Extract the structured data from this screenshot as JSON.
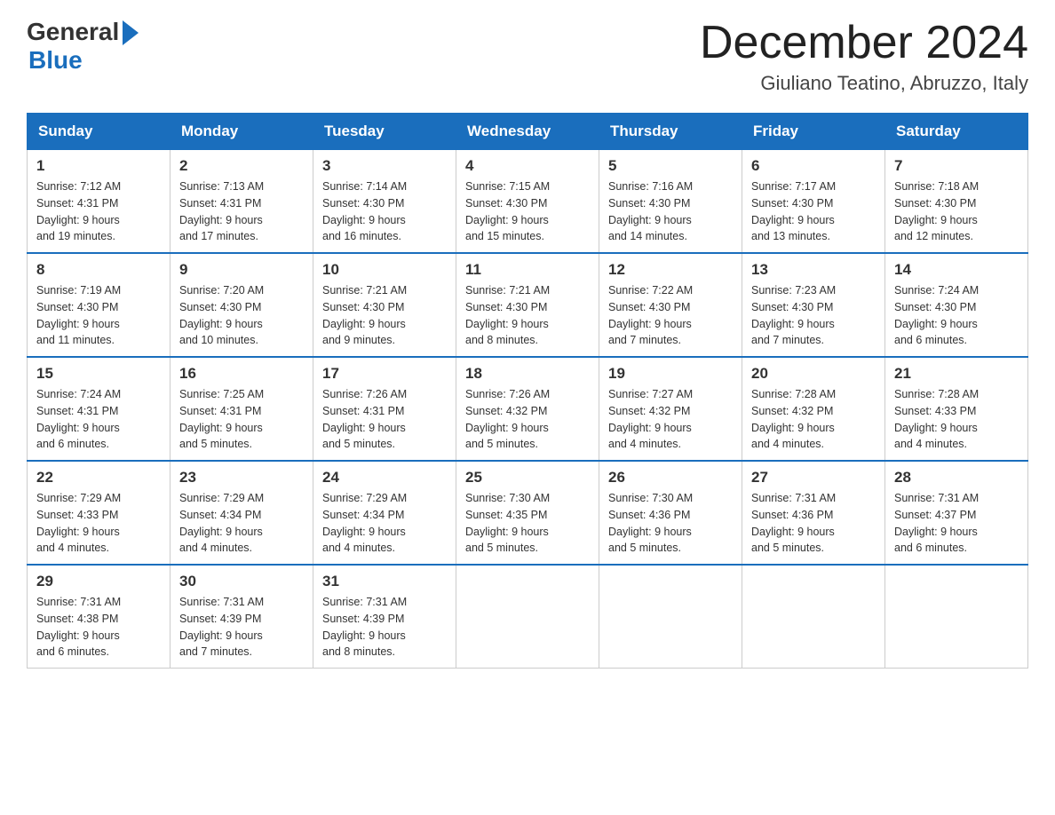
{
  "header": {
    "logo_general": "General",
    "logo_blue": "Blue",
    "month_year": "December 2024",
    "location": "Giuliano Teatino, Abruzzo, Italy"
  },
  "days_of_week": [
    "Sunday",
    "Monday",
    "Tuesday",
    "Wednesday",
    "Thursday",
    "Friday",
    "Saturday"
  ],
  "weeks": [
    [
      {
        "day": "1",
        "sunrise": "7:12 AM",
        "sunset": "4:31 PM",
        "daylight": "9 hours and 19 minutes."
      },
      {
        "day": "2",
        "sunrise": "7:13 AM",
        "sunset": "4:31 PM",
        "daylight": "9 hours and 17 minutes."
      },
      {
        "day": "3",
        "sunrise": "7:14 AM",
        "sunset": "4:30 PM",
        "daylight": "9 hours and 16 minutes."
      },
      {
        "day": "4",
        "sunrise": "7:15 AM",
        "sunset": "4:30 PM",
        "daylight": "9 hours and 15 minutes."
      },
      {
        "day": "5",
        "sunrise": "7:16 AM",
        "sunset": "4:30 PM",
        "daylight": "9 hours and 14 minutes."
      },
      {
        "day": "6",
        "sunrise": "7:17 AM",
        "sunset": "4:30 PM",
        "daylight": "9 hours and 13 minutes."
      },
      {
        "day": "7",
        "sunrise": "7:18 AM",
        "sunset": "4:30 PM",
        "daylight": "9 hours and 12 minutes."
      }
    ],
    [
      {
        "day": "8",
        "sunrise": "7:19 AM",
        "sunset": "4:30 PM",
        "daylight": "9 hours and 11 minutes."
      },
      {
        "day": "9",
        "sunrise": "7:20 AM",
        "sunset": "4:30 PM",
        "daylight": "9 hours and 10 minutes."
      },
      {
        "day": "10",
        "sunrise": "7:21 AM",
        "sunset": "4:30 PM",
        "daylight": "9 hours and 9 minutes."
      },
      {
        "day": "11",
        "sunrise": "7:21 AM",
        "sunset": "4:30 PM",
        "daylight": "9 hours and 8 minutes."
      },
      {
        "day": "12",
        "sunrise": "7:22 AM",
        "sunset": "4:30 PM",
        "daylight": "9 hours and 7 minutes."
      },
      {
        "day": "13",
        "sunrise": "7:23 AM",
        "sunset": "4:30 PM",
        "daylight": "9 hours and 7 minutes."
      },
      {
        "day": "14",
        "sunrise": "7:24 AM",
        "sunset": "4:30 PM",
        "daylight": "9 hours and 6 minutes."
      }
    ],
    [
      {
        "day": "15",
        "sunrise": "7:24 AM",
        "sunset": "4:31 PM",
        "daylight": "9 hours and 6 minutes."
      },
      {
        "day": "16",
        "sunrise": "7:25 AM",
        "sunset": "4:31 PM",
        "daylight": "9 hours and 5 minutes."
      },
      {
        "day": "17",
        "sunrise": "7:26 AM",
        "sunset": "4:31 PM",
        "daylight": "9 hours and 5 minutes."
      },
      {
        "day": "18",
        "sunrise": "7:26 AM",
        "sunset": "4:32 PM",
        "daylight": "9 hours and 5 minutes."
      },
      {
        "day": "19",
        "sunrise": "7:27 AM",
        "sunset": "4:32 PM",
        "daylight": "9 hours and 4 minutes."
      },
      {
        "day": "20",
        "sunrise": "7:28 AM",
        "sunset": "4:32 PM",
        "daylight": "9 hours and 4 minutes."
      },
      {
        "day": "21",
        "sunrise": "7:28 AM",
        "sunset": "4:33 PM",
        "daylight": "9 hours and 4 minutes."
      }
    ],
    [
      {
        "day": "22",
        "sunrise": "7:29 AM",
        "sunset": "4:33 PM",
        "daylight": "9 hours and 4 minutes."
      },
      {
        "day": "23",
        "sunrise": "7:29 AM",
        "sunset": "4:34 PM",
        "daylight": "9 hours and 4 minutes."
      },
      {
        "day": "24",
        "sunrise": "7:29 AM",
        "sunset": "4:34 PM",
        "daylight": "9 hours and 4 minutes."
      },
      {
        "day": "25",
        "sunrise": "7:30 AM",
        "sunset": "4:35 PM",
        "daylight": "9 hours and 5 minutes."
      },
      {
        "day": "26",
        "sunrise": "7:30 AM",
        "sunset": "4:36 PM",
        "daylight": "9 hours and 5 minutes."
      },
      {
        "day": "27",
        "sunrise": "7:31 AM",
        "sunset": "4:36 PM",
        "daylight": "9 hours and 5 minutes."
      },
      {
        "day": "28",
        "sunrise": "7:31 AM",
        "sunset": "4:37 PM",
        "daylight": "9 hours and 6 minutes."
      }
    ],
    [
      {
        "day": "29",
        "sunrise": "7:31 AM",
        "sunset": "4:38 PM",
        "daylight": "9 hours and 6 minutes."
      },
      {
        "day": "30",
        "sunrise": "7:31 AM",
        "sunset": "4:39 PM",
        "daylight": "9 hours and 7 minutes."
      },
      {
        "day": "31",
        "sunrise": "7:31 AM",
        "sunset": "4:39 PM",
        "daylight": "9 hours and 8 minutes."
      },
      null,
      null,
      null,
      null
    ]
  ],
  "labels": {
    "sunrise": "Sunrise:",
    "sunset": "Sunset:",
    "daylight": "Daylight:"
  }
}
